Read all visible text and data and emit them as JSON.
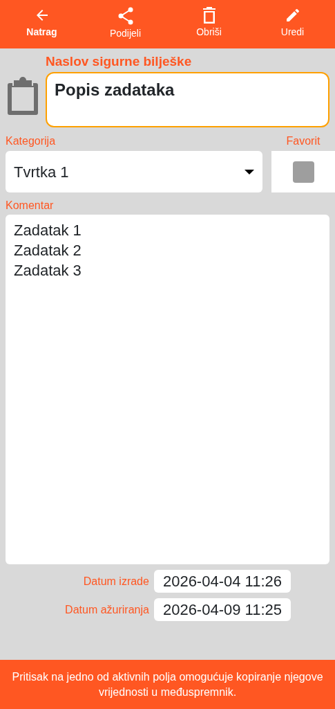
{
  "toolbar": [
    {
      "kind": "back",
      "label": "Natrag",
      "selected": true
    },
    {
      "kind": "share",
      "label": "Podijeli",
      "selected": false
    },
    {
      "kind": "delete",
      "label": "Obriši",
      "selected": false
    },
    {
      "kind": "edit",
      "label": "Uredi",
      "selected": false
    }
  ],
  "title": {
    "label": "Naslov sigurne bilješke",
    "value": "Popis zadataka"
  },
  "category": {
    "label": "Kategorija",
    "value": "Tvrtka 1"
  },
  "favorite": {
    "label": "Favorit",
    "checked": false
  },
  "comment": {
    "label": "Komentar",
    "value": "Zadatak 1\nZadatak 2\nZadatak 3"
  },
  "dates": [
    {
      "label": "Datum izrade",
      "value": "2026-04-04 11:26"
    },
    {
      "label": "Datum ažuriranja",
      "value": "2026-04-09 11:25"
    }
  ],
  "footer": "Pritisak na jedno od aktivnih polja omogućuje kopiranje njegove vrijednosti u međuspremnik."
}
